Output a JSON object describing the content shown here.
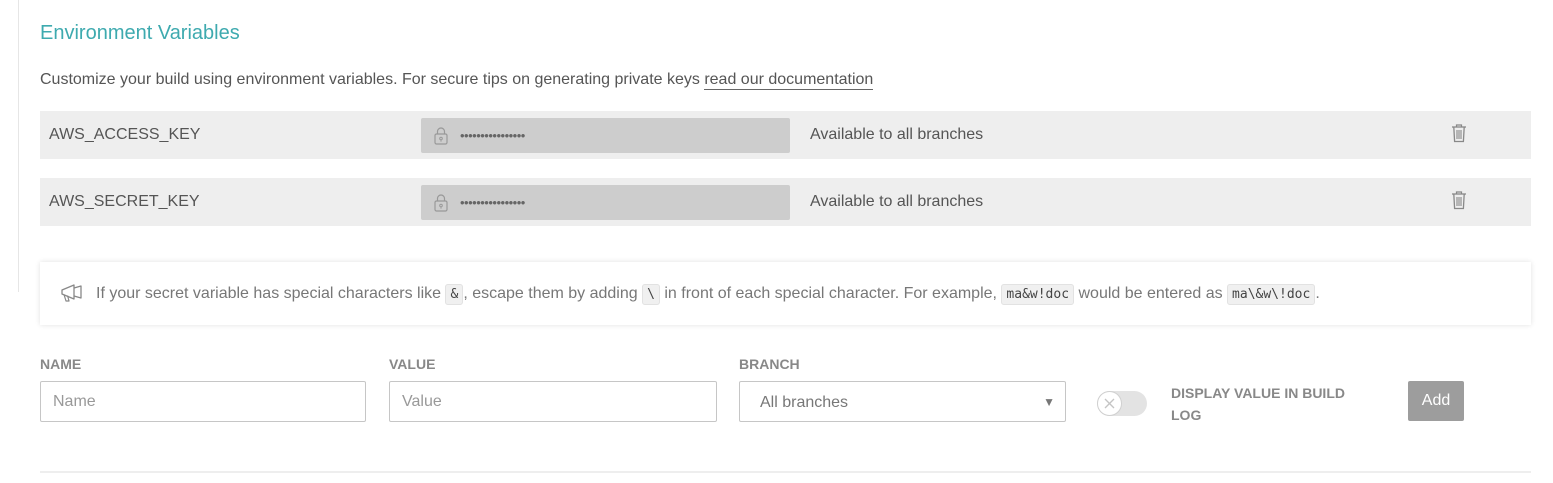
{
  "section": {
    "title": "Environment Variables",
    "intro_text": "Customize your build using environment variables. For secure tips on generating private keys ",
    "intro_link": "read our documentation"
  },
  "variables": [
    {
      "name": "AWS_ACCESS_KEY",
      "masked_value": "••••••••••••••••",
      "branch": "Available to all branches"
    },
    {
      "name": "AWS_SECRET_KEY",
      "masked_value": "••••••••••••••••",
      "branch": "Available to all branches"
    }
  ],
  "notice": {
    "text_1": "If your secret variable has special characters like ",
    "code_1": "&",
    "text_2": ", escape them by adding ",
    "code_2": "\\",
    "text_3": " in front of each special character. For example, ",
    "code_3": "ma&w!doc",
    "text_4": " would be entered as ",
    "code_4": "ma\\&w\\!doc",
    "text_5": "."
  },
  "form": {
    "name_label": "NAME",
    "name_placeholder": "Name",
    "value_label": "VALUE",
    "value_placeholder": "Value",
    "branch_label": "BRANCH",
    "branch_selected": "All branches",
    "toggle_label": "DISPLAY VALUE IN BUILD LOG",
    "toggle_on": false,
    "add_label": "Add"
  },
  "icons": [
    "lock-icon",
    "trash-icon",
    "megaphone-icon",
    "x-icon",
    "caret-down-icon"
  ],
  "colors": {
    "title": "#3eaaaf",
    "row_bg": "#eeeeee",
    "masked_bg": "#cdcdcd",
    "add_button": "#9d9d9d"
  }
}
